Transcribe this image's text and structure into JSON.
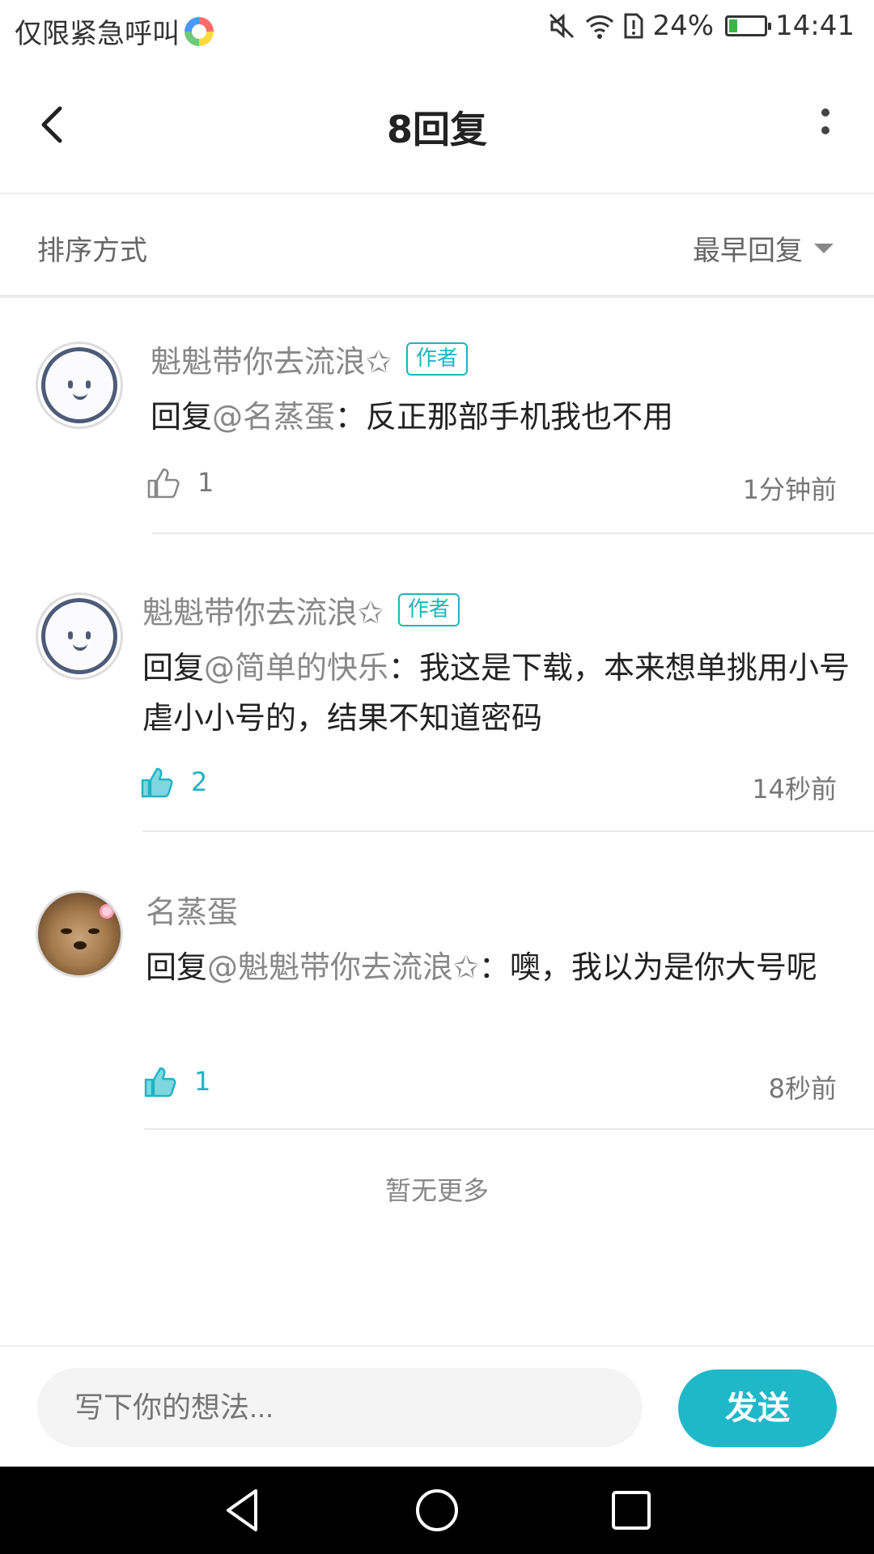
{
  "status_bar": {
    "carrier_text": "仅限紧急呼叫",
    "battery_percent": "24%",
    "battery_level": 0.24,
    "time": "14:41"
  },
  "header": {
    "title": "8回复"
  },
  "sort": {
    "label": "排序方式",
    "value": "最早回复"
  },
  "comments": [
    {
      "username": "魁魁带你去流浪✩",
      "badge": "作者",
      "reply_prefix": "回复",
      "mention": "@名蒸蛋",
      "text": "：反正那部手机我也不用",
      "likes": "1",
      "liked": false,
      "time": "1分钟前",
      "avatar": "cartoon-face"
    },
    {
      "username": "魁魁带你去流浪✩",
      "badge": "作者",
      "reply_prefix": "回复",
      "mention": "@简单的快乐",
      "text": "：我这是下载，本来想单挑用小号虐小小号的，结果不知道密码",
      "likes": "2",
      "liked": true,
      "time": "14秒前",
      "avatar": "cartoon-face"
    },
    {
      "username": "名蒸蛋",
      "badge": "",
      "reply_prefix": "回复",
      "mention": "@魁魁带你去流浪✩",
      "text": "：噢，我以为是你大号呢",
      "likes": "1",
      "liked": true,
      "time": "8秒前",
      "avatar": "dog-photo"
    }
  ],
  "footer": {
    "no_more": "暂无更多"
  },
  "input": {
    "placeholder": "写下你的想法...",
    "send_label": "发送"
  },
  "colors": {
    "accent": "#1fb8c8",
    "muted_text": "#888888"
  }
}
